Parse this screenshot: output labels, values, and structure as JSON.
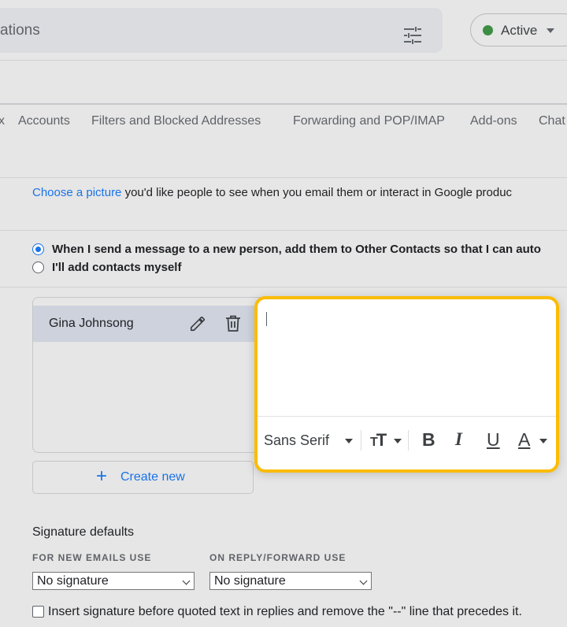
{
  "header": {
    "search_text": "ations",
    "status": {
      "label": "Active",
      "color": "#3d8d44"
    }
  },
  "tabs": [
    "x",
    "Accounts",
    "Filters and Blocked Addresses",
    "Forwarding and POP/IMAP",
    "Add-ons",
    "Chat"
  ],
  "picture": {
    "link": "Choose a picture",
    "text": " you'd like people to see when you email them or interact in Google produc"
  },
  "contacts": {
    "option_auto": "When I send a message to a new person, add them to Other Contacts so that I can auto",
    "option_manual": "I'll add contacts myself"
  },
  "signatures": {
    "items": [
      {
        "name": "Gina Johnsong"
      }
    ],
    "create_new": "Create new"
  },
  "editor": {
    "font": "Sans Serif",
    "bold": "B",
    "italic": "I",
    "underline": "U",
    "text_color": "A",
    "highlight_color": "#fbbc04"
  },
  "defaults": {
    "title": "Signature defaults",
    "new_emails_label": "FOR NEW EMAILS USE",
    "reply_label": "ON REPLY/FORWARD USE",
    "new_emails_value": "No signature",
    "reply_value": "No signature",
    "insert_before": "Insert signature before quoted text in replies and remove the \"--\" line that precedes it."
  }
}
